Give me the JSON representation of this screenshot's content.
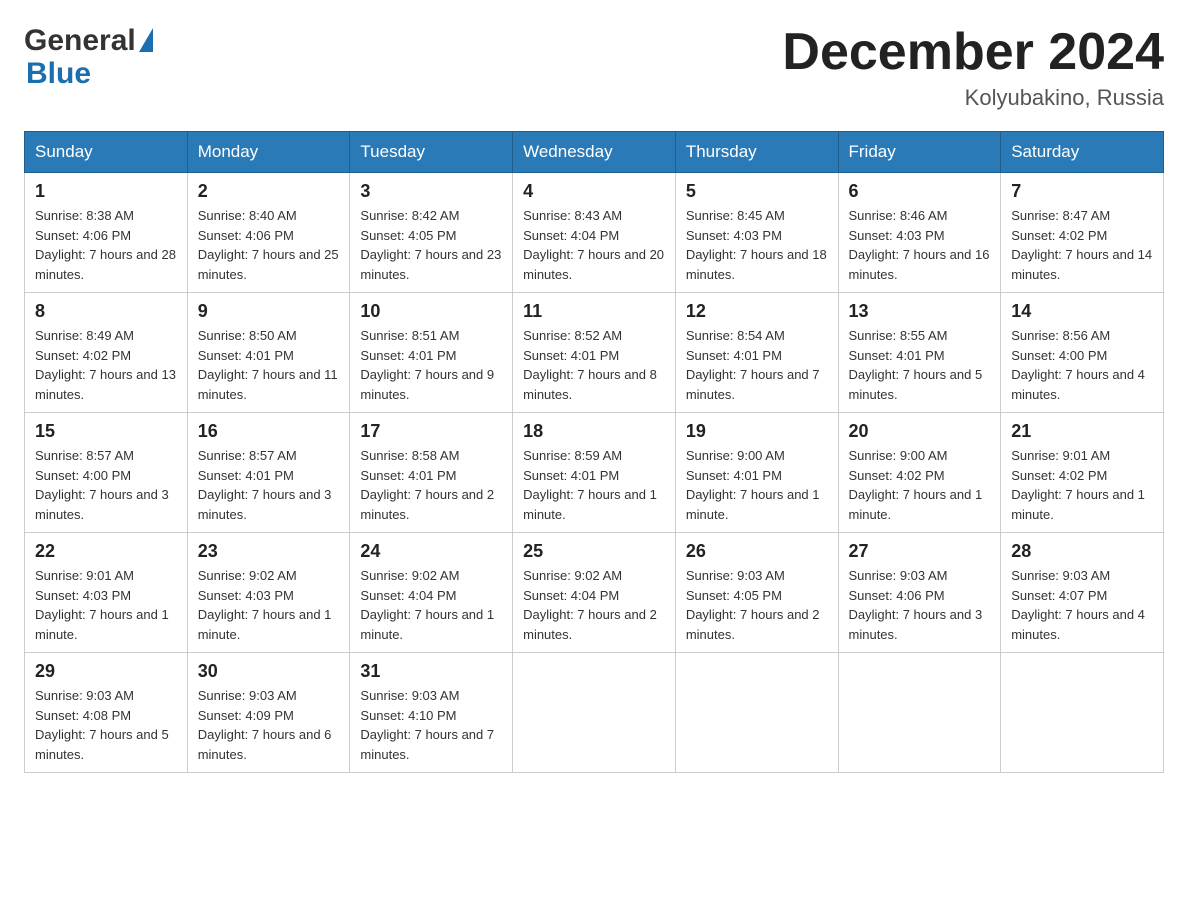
{
  "header": {
    "title": "December 2024",
    "subtitle": "Kolyubakino, Russia",
    "logo_general": "General",
    "logo_blue": "Blue"
  },
  "weekdays": [
    "Sunday",
    "Monday",
    "Tuesday",
    "Wednesday",
    "Thursday",
    "Friday",
    "Saturday"
  ],
  "weeks": [
    [
      {
        "day": "1",
        "sunrise": "8:38 AM",
        "sunset": "4:06 PM",
        "daylight": "7 hours and 28 minutes."
      },
      {
        "day": "2",
        "sunrise": "8:40 AM",
        "sunset": "4:06 PM",
        "daylight": "7 hours and 25 minutes."
      },
      {
        "day": "3",
        "sunrise": "8:42 AM",
        "sunset": "4:05 PM",
        "daylight": "7 hours and 23 minutes."
      },
      {
        "day": "4",
        "sunrise": "8:43 AM",
        "sunset": "4:04 PM",
        "daylight": "7 hours and 20 minutes."
      },
      {
        "day": "5",
        "sunrise": "8:45 AM",
        "sunset": "4:03 PM",
        "daylight": "7 hours and 18 minutes."
      },
      {
        "day": "6",
        "sunrise": "8:46 AM",
        "sunset": "4:03 PM",
        "daylight": "7 hours and 16 minutes."
      },
      {
        "day": "7",
        "sunrise": "8:47 AM",
        "sunset": "4:02 PM",
        "daylight": "7 hours and 14 minutes."
      }
    ],
    [
      {
        "day": "8",
        "sunrise": "8:49 AM",
        "sunset": "4:02 PM",
        "daylight": "7 hours and 13 minutes."
      },
      {
        "day": "9",
        "sunrise": "8:50 AM",
        "sunset": "4:01 PM",
        "daylight": "7 hours and 11 minutes."
      },
      {
        "day": "10",
        "sunrise": "8:51 AM",
        "sunset": "4:01 PM",
        "daylight": "7 hours and 9 minutes."
      },
      {
        "day": "11",
        "sunrise": "8:52 AM",
        "sunset": "4:01 PM",
        "daylight": "7 hours and 8 minutes."
      },
      {
        "day": "12",
        "sunrise": "8:54 AM",
        "sunset": "4:01 PM",
        "daylight": "7 hours and 7 minutes."
      },
      {
        "day": "13",
        "sunrise": "8:55 AM",
        "sunset": "4:01 PM",
        "daylight": "7 hours and 5 minutes."
      },
      {
        "day": "14",
        "sunrise": "8:56 AM",
        "sunset": "4:00 PM",
        "daylight": "7 hours and 4 minutes."
      }
    ],
    [
      {
        "day": "15",
        "sunrise": "8:57 AM",
        "sunset": "4:00 PM",
        "daylight": "7 hours and 3 minutes."
      },
      {
        "day": "16",
        "sunrise": "8:57 AM",
        "sunset": "4:01 PM",
        "daylight": "7 hours and 3 minutes."
      },
      {
        "day": "17",
        "sunrise": "8:58 AM",
        "sunset": "4:01 PM",
        "daylight": "7 hours and 2 minutes."
      },
      {
        "day": "18",
        "sunrise": "8:59 AM",
        "sunset": "4:01 PM",
        "daylight": "7 hours and 1 minute."
      },
      {
        "day": "19",
        "sunrise": "9:00 AM",
        "sunset": "4:01 PM",
        "daylight": "7 hours and 1 minute."
      },
      {
        "day": "20",
        "sunrise": "9:00 AM",
        "sunset": "4:02 PM",
        "daylight": "7 hours and 1 minute."
      },
      {
        "day": "21",
        "sunrise": "9:01 AM",
        "sunset": "4:02 PM",
        "daylight": "7 hours and 1 minute."
      }
    ],
    [
      {
        "day": "22",
        "sunrise": "9:01 AM",
        "sunset": "4:03 PM",
        "daylight": "7 hours and 1 minute."
      },
      {
        "day": "23",
        "sunrise": "9:02 AM",
        "sunset": "4:03 PM",
        "daylight": "7 hours and 1 minute."
      },
      {
        "day": "24",
        "sunrise": "9:02 AM",
        "sunset": "4:04 PM",
        "daylight": "7 hours and 1 minute."
      },
      {
        "day": "25",
        "sunrise": "9:02 AM",
        "sunset": "4:04 PM",
        "daylight": "7 hours and 2 minutes."
      },
      {
        "day": "26",
        "sunrise": "9:03 AM",
        "sunset": "4:05 PM",
        "daylight": "7 hours and 2 minutes."
      },
      {
        "day": "27",
        "sunrise": "9:03 AM",
        "sunset": "4:06 PM",
        "daylight": "7 hours and 3 minutes."
      },
      {
        "day": "28",
        "sunrise": "9:03 AM",
        "sunset": "4:07 PM",
        "daylight": "7 hours and 4 minutes."
      }
    ],
    [
      {
        "day": "29",
        "sunrise": "9:03 AM",
        "sunset": "4:08 PM",
        "daylight": "7 hours and 5 minutes."
      },
      {
        "day": "30",
        "sunrise": "9:03 AM",
        "sunset": "4:09 PM",
        "daylight": "7 hours and 6 minutes."
      },
      {
        "day": "31",
        "sunrise": "9:03 AM",
        "sunset": "4:10 PM",
        "daylight": "7 hours and 7 minutes."
      },
      null,
      null,
      null,
      null
    ]
  ]
}
